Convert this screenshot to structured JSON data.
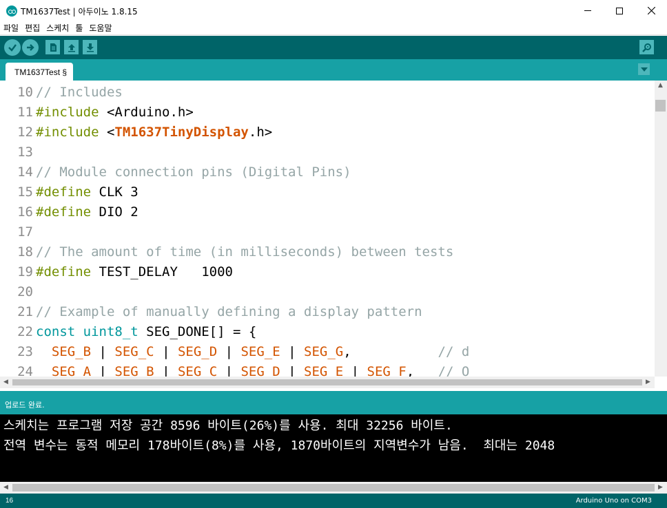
{
  "window": {
    "title": "TM1637Test | 아두이노 1.8.15"
  },
  "menu": [
    "파일",
    "편집",
    "스케치",
    "툴",
    "도움말"
  ],
  "toolbar": {
    "buttons": [
      "verify-icon",
      "upload-icon",
      "new-icon",
      "open-icon",
      "save-icon",
      "serial-monitor-icon"
    ]
  },
  "tabs": [
    {
      "label": "TM1637Test §"
    }
  ],
  "editor": {
    "lines": [
      {
        "n": "10",
        "tokens": [
          {
            "t": "// Includes",
            "c": "comment"
          }
        ]
      },
      {
        "n": "11",
        "tokens": [
          {
            "t": "#include",
            "c": "pre"
          },
          {
            "t": " <Arduino.h>",
            "c": ""
          }
        ]
      },
      {
        "n": "12",
        "tokens": [
          {
            "t": "#include",
            "c": "pre"
          },
          {
            "t": " <",
            "c": ""
          },
          {
            "t": "TM1637TinyDisplay",
            "c": "lib"
          },
          {
            "t": ".h>",
            "c": ""
          }
        ]
      },
      {
        "n": "13",
        "tokens": []
      },
      {
        "n": "14",
        "tokens": [
          {
            "t": "// Module connection pins (Digital Pins)",
            "c": "comment"
          }
        ]
      },
      {
        "n": "15",
        "tokens": [
          {
            "t": "#define",
            "c": "pre"
          },
          {
            "t": " CLK 3",
            "c": ""
          }
        ]
      },
      {
        "n": "16",
        "tokens": [
          {
            "t": "#define",
            "c": "pre"
          },
          {
            "t": " DIO 2",
            "c": ""
          }
        ]
      },
      {
        "n": "17",
        "tokens": []
      },
      {
        "n": "18",
        "tokens": [
          {
            "t": "// The amount of time (in milliseconds) between tests",
            "c": "comment"
          }
        ]
      },
      {
        "n": "19",
        "tokens": [
          {
            "t": "#define",
            "c": "pre"
          },
          {
            "t": " TEST_DELAY   1000",
            "c": ""
          }
        ]
      },
      {
        "n": "20",
        "tokens": []
      },
      {
        "n": "21",
        "tokens": [
          {
            "t": "// Example of manually defining a display pattern",
            "c": "comment"
          }
        ]
      },
      {
        "n": "22",
        "tokens": [
          {
            "t": "const",
            "c": "type"
          },
          {
            "t": " ",
            "c": ""
          },
          {
            "t": "uint8_t",
            "c": "type"
          },
          {
            "t": " SEG_DONE[] = {",
            "c": ""
          }
        ]
      },
      {
        "n": "23",
        "tokens": [
          {
            "t": "  ",
            "c": ""
          },
          {
            "t": "SEG_B",
            "c": "const"
          },
          {
            "t": " | ",
            "c": ""
          },
          {
            "t": "SEG_C",
            "c": "const"
          },
          {
            "t": " | ",
            "c": ""
          },
          {
            "t": "SEG_D",
            "c": "const"
          },
          {
            "t": " | ",
            "c": ""
          },
          {
            "t": "SEG_E",
            "c": "const"
          },
          {
            "t": " | ",
            "c": ""
          },
          {
            "t": "SEG_G",
            "c": "const"
          },
          {
            "t": ",           ",
            "c": ""
          },
          {
            "t": "// d",
            "c": "comment"
          }
        ]
      },
      {
        "n": "24",
        "tokens": [
          {
            "t": "  ",
            "c": ""
          },
          {
            "t": "SEG_A",
            "c": "const"
          },
          {
            "t": " | ",
            "c": ""
          },
          {
            "t": "SEG_B",
            "c": "const"
          },
          {
            "t": " | ",
            "c": ""
          },
          {
            "t": "SEG_C",
            "c": "const"
          },
          {
            "t": " | ",
            "c": ""
          },
          {
            "t": "SEG_D",
            "c": "const"
          },
          {
            "t": " | ",
            "c": ""
          },
          {
            "t": "SEG_E",
            "c": "const"
          },
          {
            "t": " | ",
            "c": ""
          },
          {
            "t": "SEG_F",
            "c": "const"
          },
          {
            "t": ",   ",
            "c": ""
          },
          {
            "t": "// O",
            "c": "comment"
          }
        ]
      }
    ]
  },
  "status": {
    "message": "업로드 완료."
  },
  "console": {
    "lines": [
      "스케치는 프로그램 저장 공간 8596 바이트(26%)를 사용. 최대 32256 바이트.",
      "전역 변수는 동적 메모리 178바이트(8%)를 사용, 1870바이트의 지역변수가 남음.  최대는 2048"
    ]
  },
  "footer": {
    "line_number": "16",
    "board": "Arduino Uno on COM3"
  },
  "colors": {
    "toolbar_bg": "#006468",
    "tab_bg": "#17a1a5",
    "button_bg": "#4db7bb",
    "comment": "#95a5a6",
    "preprocessor": "#728e00",
    "type": "#00979c",
    "constant": "#d35400"
  }
}
